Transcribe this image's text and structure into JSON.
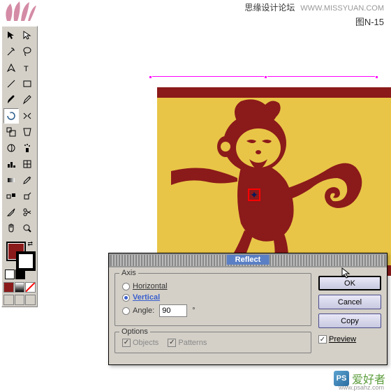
{
  "watermark": {
    "site_title": "思缘设计论坛",
    "site_url": "WWW.MISSYUAN.COM",
    "figure_label": "图N-15"
  },
  "colors": {
    "fill": "#8b1a1a",
    "artwork_bg": "#8b1a1a",
    "artwork_inner": "#e8c547"
  },
  "dialog": {
    "title": "Reflect",
    "axis_label": "Axis",
    "horizontal": "Horizontal",
    "vertical": "Vertical",
    "angle_label": "Angle:",
    "angle_value": "90",
    "angle_unit": "°",
    "options_label": "Options",
    "objects": "Objects",
    "patterns": "Patterns",
    "ok": "OK",
    "cancel": "Cancel",
    "copy": "Copy",
    "preview": "Preview",
    "selected_axis": "vertical",
    "preview_checked": true
  },
  "bottom_watermark": {
    "logo_text": "PS",
    "text": "爱好者",
    "url": "www.psahz.com"
  }
}
